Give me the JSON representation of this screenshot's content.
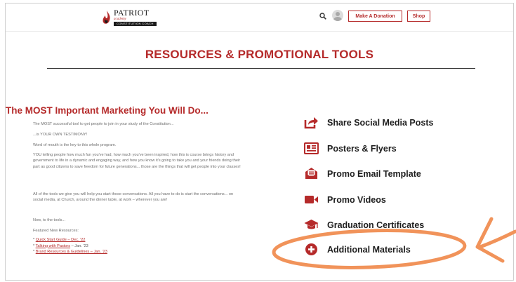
{
  "header": {
    "logo_name": "PATRIOT",
    "logo_tagline": "academy",
    "logo_sub": "CONSTITUTION COACH",
    "donate_label": "Make A Donation",
    "shop_label": "Shop"
  },
  "page": {
    "title": "RESOURCES & PROMOTIONAL TOOLS"
  },
  "intro": {
    "heading": "The MOST Important Marketing You Will Do...",
    "paragraphs": [
      "The MOST successful tool to get people to join in your study of the Constitution...",
      "...is YOUR OWN TESTIMONY!",
      "Word of mouth is the key to this whole program.",
      "YOU telling people how much fun you've had, how much you've been inspired, how this is course brings history and government to life in a dynamic and engaging way, and how you know it's going to take you and your friends doing their part as good citizens to save freedom for future generations... those are the things that will get people into your classes!",
      "All of the tools we give you will help you start those conversations. All you have to do is start the conversations... on social media, at Church, around the dinner table, at work – wherever you are!",
      "Now, to the tools...",
      "Featured New Resources:"
    ],
    "featured": [
      {
        "prefix": "* ",
        "link": "Quick Start Guide – Dec. '22",
        "suffix": ""
      },
      {
        "prefix": "* ",
        "link": "Talking with Pastors",
        "suffix": " – Jan. '23"
      },
      {
        "prefix": "* ",
        "link": "Brand Resources & Guidelines – Jan. '23",
        "suffix": ""
      }
    ]
  },
  "resources": [
    {
      "label": "Share Social Media Posts",
      "icon": "share-icon"
    },
    {
      "label": "Posters & Flyers",
      "icon": "poster-icon"
    },
    {
      "label": "Promo Email Template",
      "icon": "email-icon"
    },
    {
      "label": "Promo Videos",
      "icon": "video-camera-icon"
    },
    {
      "label": "Graduation Certificates",
      "icon": "graduation-cap-icon"
    },
    {
      "label": "Additional Materials",
      "icon": "plus-circle-icon"
    }
  ],
  "colors": {
    "brand_red": "#b52a2a",
    "highlight_orange": "#f1935a",
    "text_dark": "#1e1e1e"
  }
}
